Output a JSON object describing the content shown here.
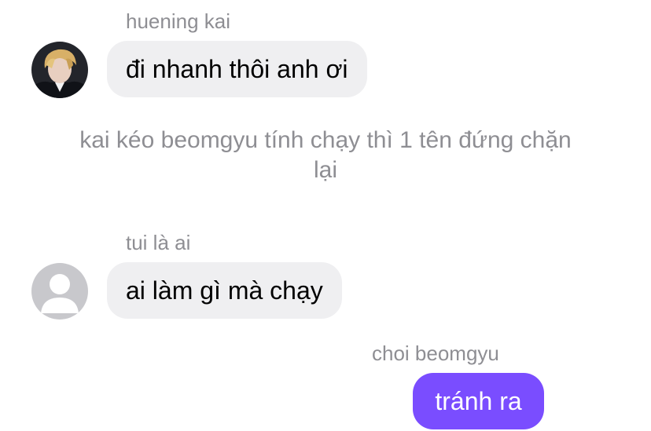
{
  "messages": [
    {
      "sender": "huening kai",
      "text": "đi nhanh thôi anh ơi",
      "direction": "incoming",
      "avatar_icon": "photo-avatar-icon"
    },
    {
      "type": "narration",
      "text": "kai kéo beomgyu tính chạy thì 1 tên đứng chặn lại"
    },
    {
      "sender": "tui là ai",
      "text": "ai làm gì mà chạy",
      "direction": "incoming",
      "avatar_icon": "default-user-avatar-icon"
    },
    {
      "sender": "choi beomgyu",
      "text": "tránh ra",
      "direction": "outgoing"
    }
  ],
  "colors": {
    "incoming_bubble": "#efeff1",
    "outgoing_bubble": "#7a4dff",
    "sender_label": "#8e8e93",
    "narration_text": "#8e8e93"
  }
}
